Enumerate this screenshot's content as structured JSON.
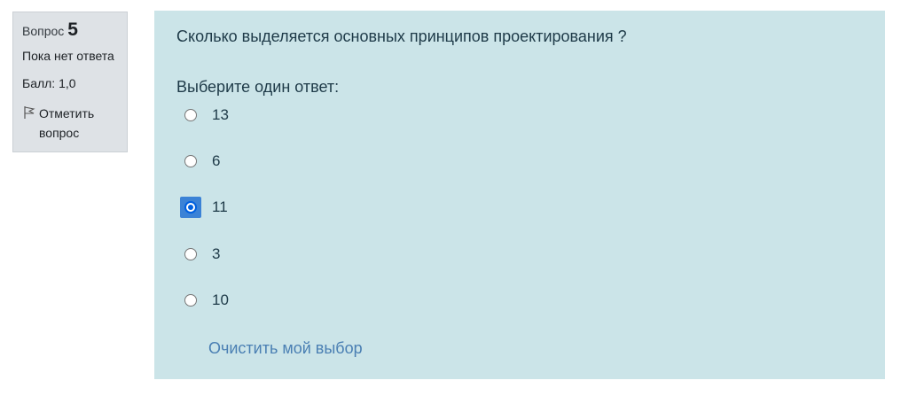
{
  "info": {
    "question_label": "Вопрос",
    "question_number": "5",
    "state": "Пока нет ответа",
    "grade": "Балл: 1,0",
    "flag_label": "Отметить вопрос",
    "flag_icon": "flag-icon"
  },
  "question": {
    "text": "Сколько выделяется основных принципов проектирования ?",
    "prompt": "Выберите один ответ:",
    "options": [
      {
        "label": "13",
        "selected": false
      },
      {
        "label": "6",
        "selected": false
      },
      {
        "label": "11",
        "selected": true
      },
      {
        "label": "3",
        "selected": false
      },
      {
        "label": "10",
        "selected": false
      }
    ],
    "clear_label": "Очистить мой выбор"
  },
  "colors": {
    "info_background": "#dee2e6",
    "content_background": "#cbe4e8",
    "link": "#4a7fb3",
    "radio_selected": "#0060df"
  }
}
